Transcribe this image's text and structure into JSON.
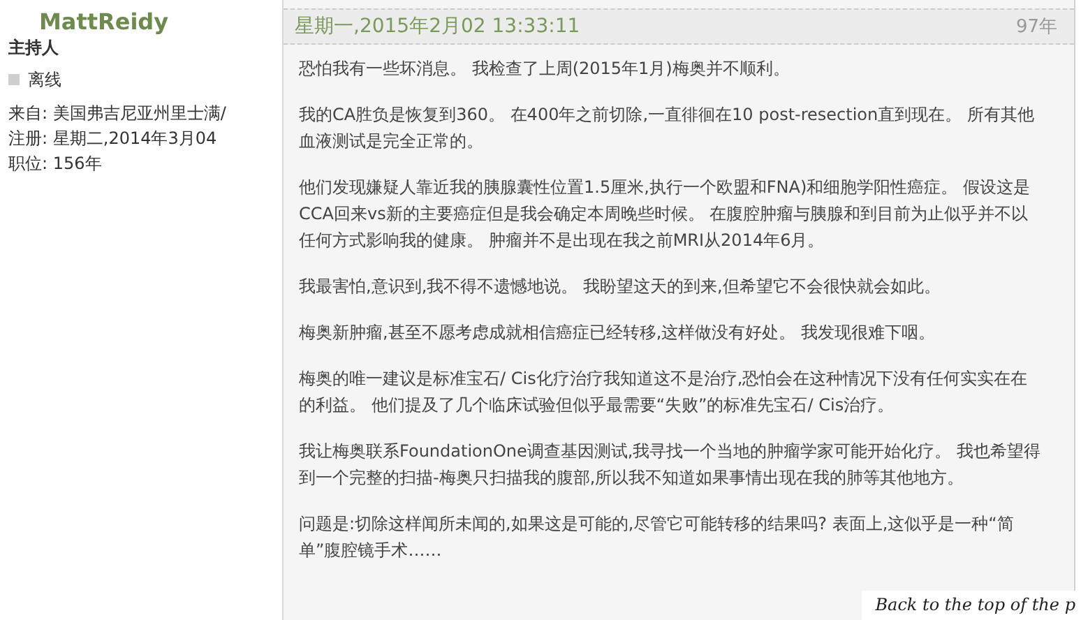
{
  "author": {
    "name": "MattReidy",
    "role": "主持人",
    "status": "离线",
    "online": false,
    "details": [
      {
        "label": "来自:",
        "value": "美国弗吉尼亚州里士满/"
      },
      {
        "label": "注册:",
        "value": "星期二,2014年3月04"
      },
      {
        "label": "职位:",
        "value": "156年"
      }
    ]
  },
  "post": {
    "date": "星期一,2015年2月02 13:33:11",
    "number": "97年",
    "paragraphs": [
      "恐怕我有一些坏消息。 我检查了上周(2015年1月)梅奥并不顺利。",
      "我的CA胜负是恢复到360。 在400年之前切除,一直徘徊在10 post-resection直到现在。 所有其他血液测试是完全正常的。",
      "他们发现嫌疑人靠近我的胰腺囊性位置1.5厘米,执行一个欧盟和FNA)和细胞学阳性癌症。 假设这是CCA回来vs新的主要癌症但是我会确定本周晚些时候。 在腹腔肿瘤与胰腺和到目前为止似乎并不以任何方式影响我的健康。 肿瘤并不是出现在我之前MRI从2014年6月。",
      "我最害怕,意识到,我不得不遗憾地说。 我盼望这天的到来,但希望它不会很快就会如此。",
      "梅奥新肿瘤,甚至不愿考虑成就相信癌症已经转移,这样做没有好处。 我发现很难下咽。",
      "梅奥的唯一建议是标准宝石/ Cis化疗治疗我知道这不是治疗,恐怕会在这种情况下没有任何实实在在的利益。 他们提及了几个临床试验但似乎最需要“失败”的标准先宝石/ Cis治疗。",
      "我让梅奥联系FoundationOne调查基因测试,我寻找一个当地的肿瘤学家可能开始化疗。 我也希望得到一个完整的扫描-梅奥只扫描我的腹部,所以我不知道如果事情出现在我的肺等其他地方。",
      "问题是:切除这样闻所未闻的,如果这是可能的,尽管它可能转移的结果吗? 表面上,这似乎是一种“简单”腹腔镜手术……"
    ]
  },
  "back_to_top": "Back to the top of the p"
}
